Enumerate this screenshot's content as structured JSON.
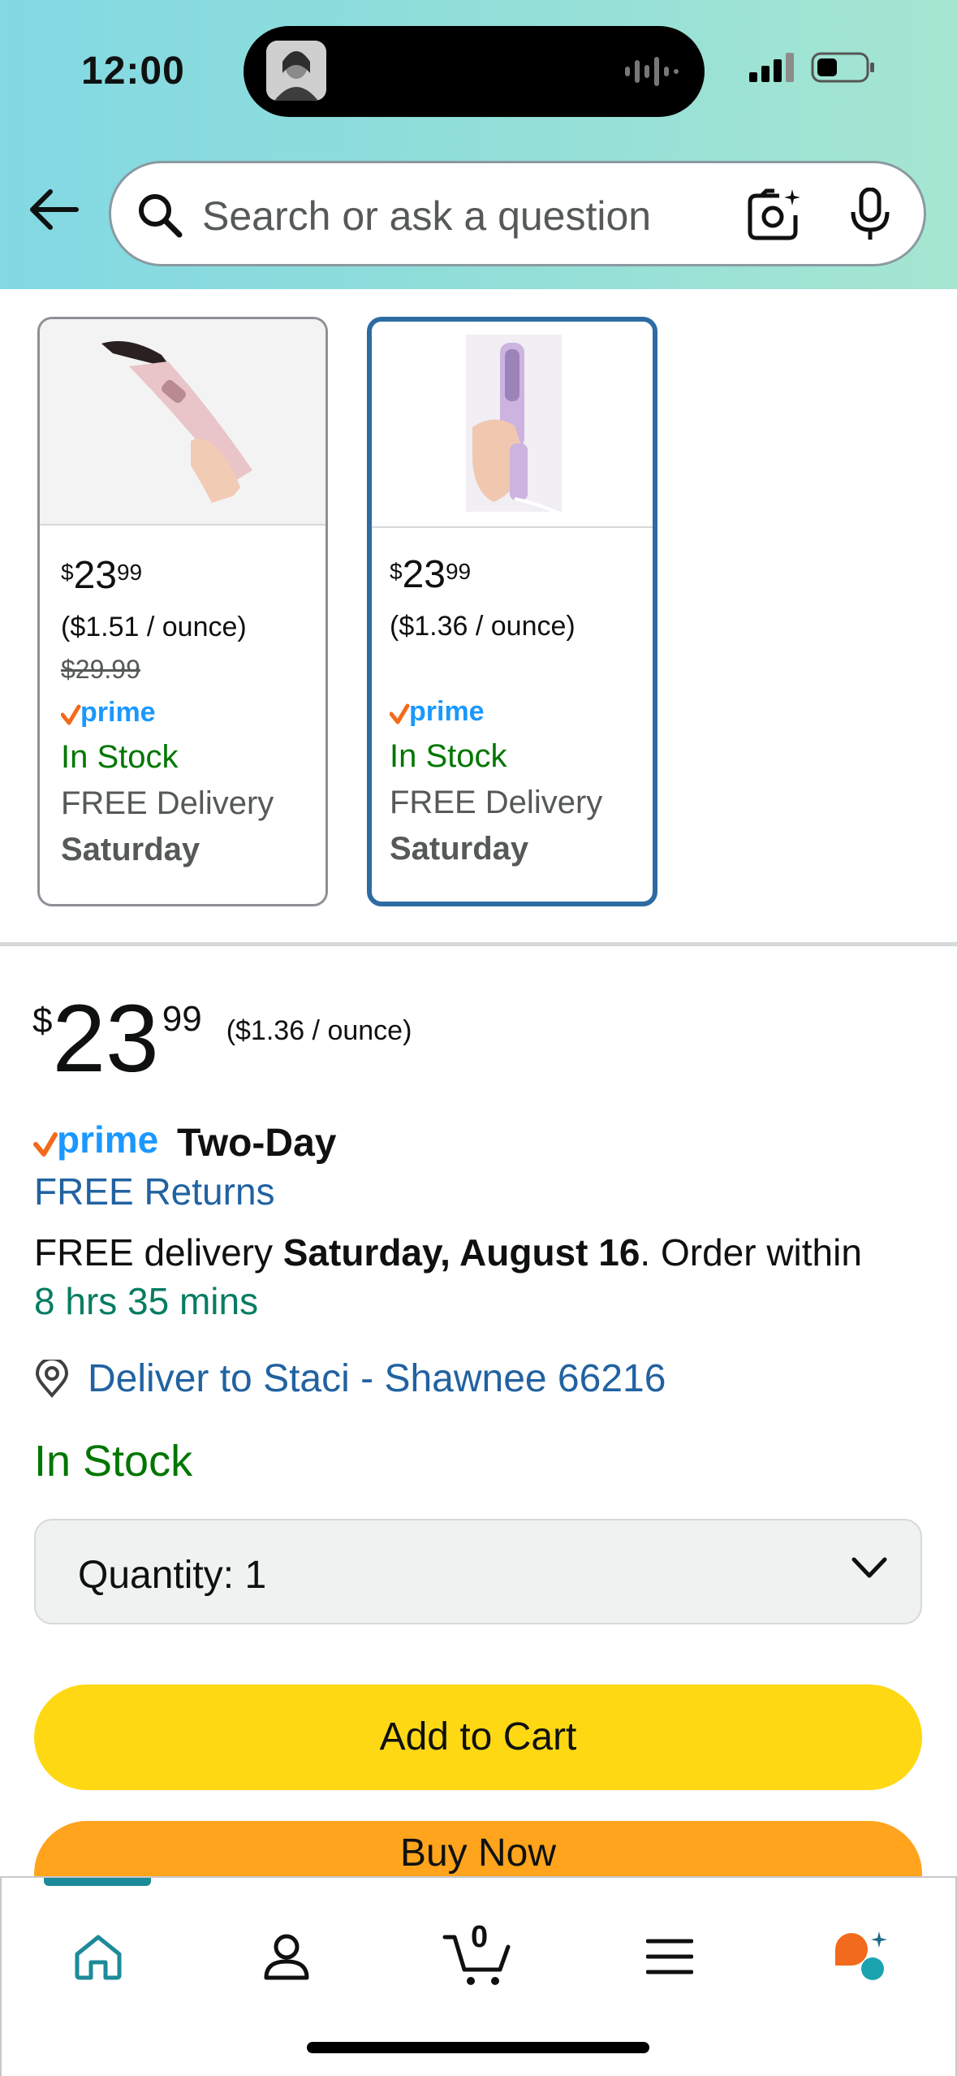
{
  "status_bar": {
    "time": "12:00"
  },
  "search": {
    "placeholder": "Search or ask a question"
  },
  "variants": [
    {
      "price_symbol": "$",
      "price_whole": "23",
      "price_fraction": "99",
      "unit_price": "($1.51 / ounce)",
      "list_price": "$29.99",
      "prime_label": "prime",
      "stock": "In Stock",
      "delivery": "FREE Delivery",
      "delivery_day": "Saturday",
      "selected": false
    },
    {
      "price_symbol": "$",
      "price_whole": "23",
      "price_fraction": "99",
      "unit_price": "($1.36 / ounce)",
      "list_price": "",
      "prime_label": "prime",
      "stock": "In Stock",
      "delivery": "FREE Delivery",
      "delivery_day": "Saturday",
      "selected": true
    }
  ],
  "buybox": {
    "price_symbol": "$",
    "price_whole": "23",
    "price_fraction": "99",
    "unit_price": "($1.36 / ounce)",
    "prime_label": "prime",
    "prime_tier": "Two-Day",
    "free_returns": "FREE Returns",
    "delivery_prefix": "FREE delivery ",
    "delivery_date": "Saturday, August 16",
    "delivery_suffix": ". Order within ",
    "order_within": "8 hrs 35 mins",
    "deliver_to": "Deliver to Staci - Shawnee 66216",
    "stock": "In Stock",
    "quantity_label": "Quantity:",
    "quantity_value": "1",
    "add_to_cart": "Add to Cart",
    "buy_now": "Buy Now"
  },
  "bottom_nav": {
    "items": [
      {
        "icon": "home-icon",
        "active": true
      },
      {
        "icon": "account-icon"
      },
      {
        "icon": "cart-icon",
        "count": "0"
      },
      {
        "icon": "menu-icon"
      },
      {
        "icon": "rufus-ai-icon"
      }
    ]
  },
  "colors": {
    "link": "#2162a1",
    "in_stock": "#007600",
    "add_to_cart": "#ffd814",
    "buy_now": "#ffa41c",
    "prime_blue": "#1a98ff",
    "prime_check": "#f26a1b",
    "selected_border": "#2e6ba3"
  }
}
